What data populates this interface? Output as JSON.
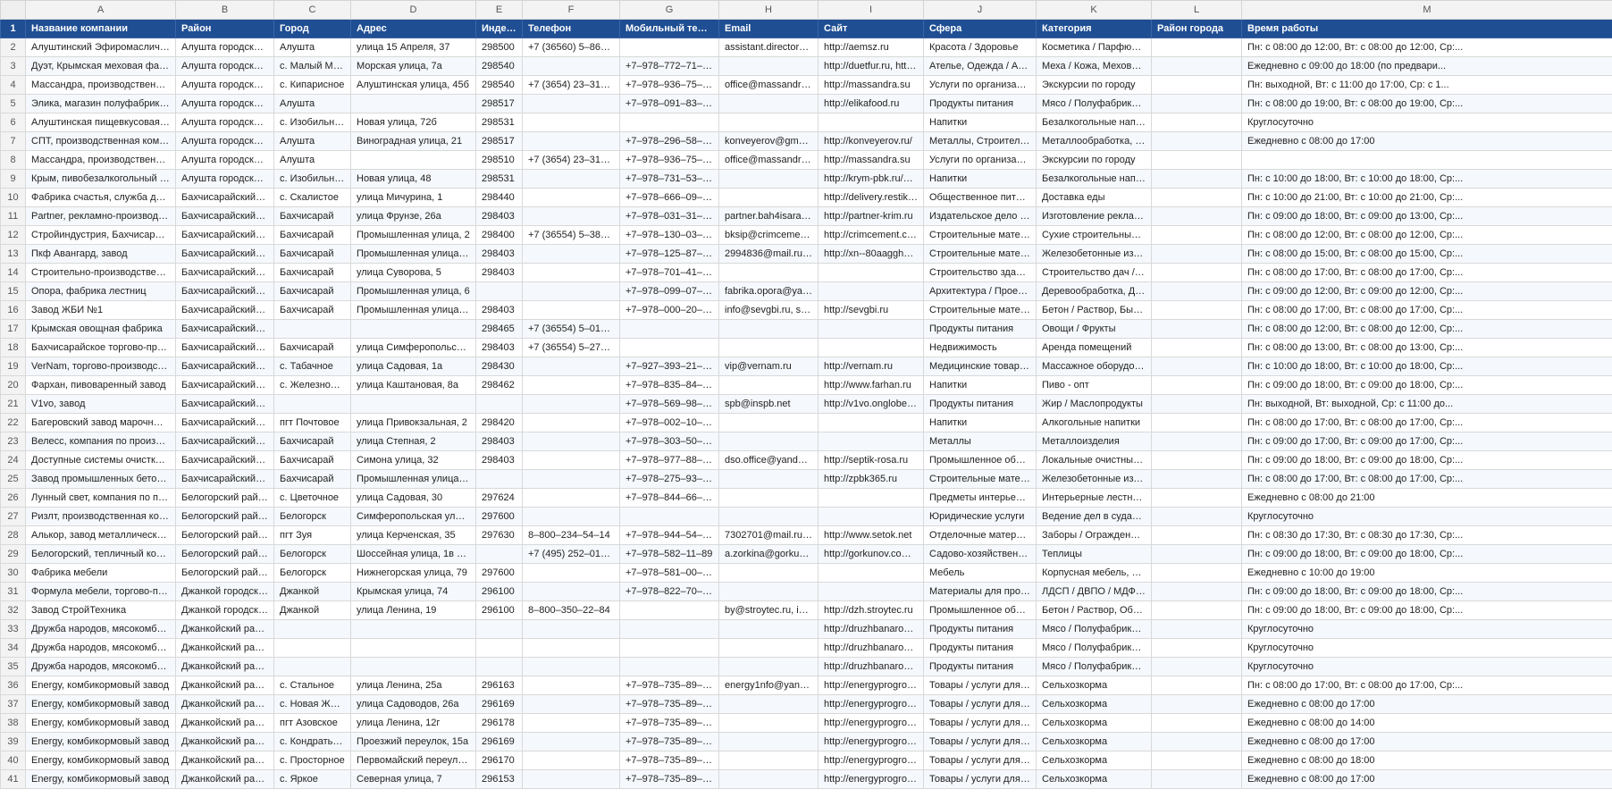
{
  "colors": {
    "header_bg": "#1f4e93",
    "header_text": "#ffffff",
    "grid_line": "#d9d9d9",
    "row_header_bg": "#f3f3f3"
  },
  "column_letters": [
    "A",
    "B",
    "C",
    "D",
    "E",
    "F",
    "G",
    "H",
    "I",
    "J",
    "K",
    "L",
    "M"
  ],
  "header": {
    "row_number": "1",
    "cells": [
      "Название компании",
      "Район",
      "Город",
      "Адрес",
      "Индекс",
      "Телефон",
      "Мобильный телефон",
      "Email",
      "Сайт",
      "Сфера",
      "Категория",
      "Район города",
      "Время работы"
    ]
  },
  "rows": [
    {
      "n": "2",
      "c": [
        "Алуштинский Эфиромасличный Совх...",
        "Алушта городской округ",
        "Алушта",
        "улица 15 Апреля, 37",
        "298500",
        "+7 (36560) 5–86–95",
        "",
        "assistant.director@aem...",
        "http://aemsz.ru",
        "Красота / Здоровье",
        "Косметика / Парфюмерия",
        "",
        "Пн: с 08:00 до 12:00, Вт: с 08:00 до 12:00, Ср:..."
      ]
    },
    {
      "n": "3",
      "c": [
        "Дуэт, Крымская меховая фабрика",
        "Алушта городской округ",
        "с. Малый Маяк",
        "Морская улица, 7а",
        "298540",
        "",
        "+7–978–772–71–73",
        "",
        "http://duetfur.ru, http://t...",
        "Ателье, Одежда / Аксессуа...",
        "Меха / Кожа, Меховые / к...",
        "",
        "Ежедневно с 09:00 до 18:00 (по предвари..."
      ]
    },
    {
      "n": "4",
      "c": [
        "Массандра, производственно-дегуста...",
        "Алушта городской округ",
        "с. Кипарисное",
        "Алуштинская улица, 45б",
        "298540",
        "+7 (3654) 23–31–96, +7...",
        "+7–978–936–75–04, +7...",
        "office@massandra.ru",
        "http://massandra.su",
        "Услуги по организации пр...",
        "Экскурсии по городу",
        "",
        "Пн: выходной, Вт: с 11:00 до 17:00, Ср: с 1..."
      ]
    },
    {
      "n": "5",
      "c": [
        "Элика, магазин полуфабрикатов",
        "Алушта городской округ",
        "Алушта",
        "",
        "298517",
        "",
        "+7–978–091–83–89",
        "",
        "http://elikafood.ru",
        "Продукты питания",
        "Мясо / Полуфабрикаты, Яг...",
        "",
        "Пн: с 08:00 до 19:00, Вт: с 08:00 до 19:00, Ср:..."
      ]
    },
    {
      "n": "6",
      "c": [
        "Алуштинская пищевкусовая фабрика",
        "Алушта городской округ",
        "с. Изобильное",
        "Новая улица, 72б",
        "298531",
        "",
        "",
        "",
        "",
        "Напитки",
        "Безалкогольные напитки",
        "",
        "Круглосуточно"
      ]
    },
    {
      "n": "7",
      "c": [
        "СПТ, производственная компания",
        "Алушта городской округ",
        "Алушта",
        "Виноградная улица, 21",
        "298517",
        "",
        "+7–978–296–58–60",
        "konveyerov@gmail.com",
        "http://konveyerov.ru/",
        "Металлы, Строительные / ...",
        "Металлообработка, Сваро...",
        "",
        "Ежедневно с 08:00 до 17:00"
      ]
    },
    {
      "n": "8",
      "c": [
        "Массандра, производственно-дегуста...",
        "Алушта городской округ",
        "Алушта",
        "",
        "298510",
        "+7 (3654) 23–31–96, +7...",
        "+7–978–936–75–04, +7...",
        "office@massandra.ru",
        "http://massandra.su",
        "Услуги по организации пр...",
        "Экскурсии по городу",
        "",
        ""
      ]
    },
    {
      "n": "9",
      "c": [
        "Крым, пивобезалкогольный комбинат",
        "Алушта городской округ",
        "с. Изобильное",
        "Новая улица, 48",
        "298531",
        "",
        "+7–978–731–53–35",
        "",
        "http://krym-pbk.ru/onas/f...",
        "Напитки",
        "Безалкогольные напитки, ...",
        "",
        "Пн: с 10:00 до 18:00, Вт: с 10:00 до 18:00, Ср:..."
      ]
    },
    {
      "n": "10",
      "c": [
        "Фабрика счастья, служба доставки ед...",
        "Бахчисарайский район",
        "с. Скалистое",
        "улица Мичурина, 1",
        "298440",
        "",
        "+7–978–666–09–00",
        "",
        "http://delivery.restik.com/...",
        "Общественное питание",
        "Доставка еды",
        "",
        "Пн: с 10:00 до 21:00, Вт: с 10:00 до 21:00, Ср:..."
      ]
    },
    {
      "n": "11",
      "c": [
        "Partner, рекламно-производственная ...",
        "Бахчисарайский район",
        "Бахчисарай",
        "улица Фрунзе, 26а",
        "298403",
        "",
        "+7–978–031–31–35, +7...",
        "partner.bah4isarai@gm...",
        "http://partner-krim.ru",
        "Издательское дело / Поли...",
        "Изготовление рекламных ...",
        "",
        "Пн: с 09:00 до 18:00, Вт: с 09:00 до 13:00, Ср:..."
      ]
    },
    {
      "n": "12",
      "c": [
        "Стройиндустрия, Бахчисарайский ко...",
        "Бахчисарайский район",
        "Бахчисарай",
        "Промышленная улица, 2",
        "298400",
        "+7 (36554) 5–38–24, +7...",
        "+7–978–130–03–82, +7...",
        "bksip@crimcement.com...",
        "http://crimcement.com",
        "Строительные материалы ...",
        "Сухие строительные смеси...",
        "",
        "Пн: с 08:00 до 12:00, Вт: с 08:00 до 12:00, Ср:..."
      ]
    },
    {
      "n": "13",
      "c": [
        "Пкф Авангард, завод",
        "Бахчисарайский район",
        "Бахчисарай",
        "Промышленная улица, 8б",
        "298403",
        "",
        "+7–978–125–87–16",
        "2994836@mail.ru, onlin...",
        "http://xn--80aaggh0b1a...",
        "Строительные материалы ...",
        "Железобетонные изделия",
        "",
        "Пн: с 08:00 до 15:00, Вт: с 08:00 до 15:00, Ср:..."
      ]
    },
    {
      "n": "14",
      "c": [
        "Строительно-производственная фирма",
        "Бахчисарайский район",
        "Бахчисарай",
        "улица Суворова, 5",
        "298403",
        "",
        "+7–978–701–41–01",
        "",
        "",
        "Строительство зданий / со...",
        "Строительство дач / котте...",
        "",
        "Пн: с 08:00 до 17:00, Вт: с 08:00 до 17:00, Ср:..."
      ]
    },
    {
      "n": "15",
      "c": [
        "Опора, фабрика лестниц",
        "Бахчисарайский район",
        "Бахчисарай",
        "Промышленная улица, 6",
        "",
        "",
        "+7–978–099–07–99, +7...",
        "fabrika.opora@ya.ru",
        "",
        "Архитектура / Проектиров...",
        "Деревообработка, Дизайн...",
        "",
        "Пн: с 09:00 до 12:00, Вт: с 09:00 до 12:00, Ср:..."
      ]
    },
    {
      "n": "16",
      "c": [
        "Завод ЖБИ №1",
        "Бахчисарайский район",
        "Бахчисарай",
        "Промышленная улица, 25",
        "298403",
        "",
        "+7–978–000–20–19",
        "info@sevgbi.ru, sale@s...",
        "http://sevgbi.ru",
        "Строительные материалы ...",
        "Бетон / Раствор, Быстрово...",
        "",
        "Пн: с 08:00 до 17:00, Вт: с 08:00 до 17:00, Ср:..."
      ]
    },
    {
      "n": "17",
      "c": [
        "Крымская овощная фабрика",
        "Бахчисарайский район",
        "",
        "",
        "298465",
        "+7 (36554) 5–01–00, +7...",
        "",
        "",
        "",
        "Продукты питания",
        "Овощи / Фрукты",
        "",
        "Пн: с 08:00 до 12:00, Вт: с 08:00 до 12:00, Ср:..."
      ]
    },
    {
      "n": "18",
      "c": [
        "Бахчисарайское торгово-производст...",
        "Бахчисарайский район",
        "Бахчисарай",
        "улица Симферопольская, 5а",
        "298403",
        "+7 (36554) 5–27–18",
        "",
        "",
        "",
        "Недвижимость",
        "Аренда помещений",
        "",
        "Пн: с 08:00 до 13:00, Вт: с 08:00 до 13:00, Ср:..."
      ]
    },
    {
      "n": "19",
      "c": [
        "VerNam, торгово-производственная к...",
        "Бахчисарайский район",
        "с. Табачное",
        "улица Садовая, 1а",
        "298430",
        "",
        "+7–927–393–21–00, +7...",
        "vip@vernam.ru",
        "http://vernam.ru",
        "Медицинские товары, Об...",
        "Массажное оборудование...",
        "",
        "Пн: с 10:00 до 18:00, Вт: с 10:00 до 18:00, Ср:..."
      ]
    },
    {
      "n": "20",
      "c": [
        "Фархан, пивоваренный завод",
        "Бахчисарайский район",
        "с. Железнодор...",
        "улица Каштановая, 8а",
        "298462",
        "",
        "+7–978–835–84–22, +7...",
        "",
        "http://www.farhan.ru",
        "Напитки",
        "Пиво - опт",
        "",
        "Пн: с 09:00 до 18:00, Вт: с 09:00 до 18:00, Ср:..."
      ]
    },
    {
      "n": "21",
      "c": [
        "V1vo, завод",
        "Бахчисарайский район",
        "",
        "",
        "",
        "",
        "+7–978–569–98–81",
        "spb@inspb.net",
        "http://v1vo.onglobe.ru",
        "Продукты питания",
        "Жир / Маслопродукты",
        "",
        "Пн: выходной, Вт: выходной, Ср: с 11:00 до..."
      ]
    },
    {
      "n": "22",
      "c": [
        "Багеровский завод марочных коньяк...",
        "Бахчисарайский район",
        "пгт Почтовое",
        "улица Привокзальная, 2",
        "298420",
        "",
        "+7–978–002–10–73",
        "",
        "",
        "Напитки",
        "Алкогольные напитки",
        "",
        "Пн: с 08:00 до 17:00, Вт: с 08:00 до 17:00, Ср:..."
      ]
    },
    {
      "n": "23",
      "c": [
        "Велесс, компания по производству ст...",
        "Бахчисарайский район",
        "Бахчисарай",
        "улица Степная, 2",
        "298403",
        "",
        "+7–978–303–50–69",
        "",
        "",
        "Металлы",
        "Металлоизделия",
        "",
        "Пн: с 09:00 до 17:00, Вт: с 09:00 до 17:00, Ср:..."
      ]
    },
    {
      "n": "24",
      "c": [
        "Доступные системы очистки, произв...",
        "Бахчисарайский район",
        "Бахчисарай",
        "Симона улица, 32",
        "298403",
        "",
        "+7–978–977–88–99, +7...",
        "dso.office@yandex.ru",
        "http://septik-rosa.ru",
        "Промышленное оборудов...",
        "Локальные очистные соор...",
        "",
        "Пн: с 09:00 до 18:00, Вт: с 09:00 до 18:00, Ср:..."
      ]
    },
    {
      "n": "25",
      "c": [
        "Завод промышленных бетонных конс...",
        "Бахчисарайский район",
        "Бахчисарай",
        "Промышленная улица, 28",
        "",
        "",
        "+7–978–275–93–35",
        "",
        "http://zpbk365.ru",
        "Строительные материалы ...",
        "Железобетонные изделия",
        "",
        "Пн: с 08:00 до 17:00, Вт: с 08:00 до 17:00, Ср:..."
      ]
    },
    {
      "n": "26",
      "c": [
        "Лунный свет, компания по производс...",
        "Белогорский район",
        "с. Цветочное",
        "улица Садовая, 30",
        "297624",
        "",
        "+7–978–844–66–46",
        "",
        "",
        "Предметы интерьера / экс...",
        "Интерьерные лестницы, К...",
        "",
        "Ежедневно с 08:00 до 21:00"
      ]
    },
    {
      "n": "27",
      "c": [
        "Ризлт, производственная компания",
        "Белогорский район",
        "Белогорск",
        "Симферопольская улица, 41",
        "297600",
        "",
        "",
        "",
        "",
        "Юридические услуги",
        "Ведение дел в судах, Колл...",
        "",
        "Круглосуточно"
      ]
    },
    {
      "n": "28",
      "c": [
        "Алькор, завод металлической сетки",
        "Белогорский район",
        "пгт Зуя",
        "улица Керченская, 35",
        "297630",
        "8–800–234–54–14",
        "+7–978–944–54–14",
        "7302701@mail.ru, 9445...",
        "http://www.setok.net",
        "Отделочные материалы, С...",
        "Заборы / Ограждения, Лак...",
        "",
        "Пн: с 08:30 до 17:30, Вт: с 08:30 до 17:30, Ср:..."
      ]
    },
    {
      "n": "29",
      "c": [
        "Белогорский, тепличный комбинат",
        "Белогорский район",
        "Белогорск",
        "Шоссейная улица, 1в лит А ст1",
        "",
        "+7 (495) 252–01–70",
        "+7–978–582–11–89",
        "a.zorkina@gorkunov.co...",
        "http://gorkunov.com/, htt...",
        "Садово-хозяйственные то...",
        "Теплицы",
        "",
        "Пн: с 09:00 до 18:00, Вт: с 09:00 до 18:00, Ср:..."
      ]
    },
    {
      "n": "30",
      "c": [
        "Фабрика мебели",
        "Белогорский район",
        "Белогорск",
        "Нижнегорская улица, 79",
        "297600",
        "",
        "+7–978–581–00–06",
        "",
        "",
        "Мебель",
        "Корпусная мебель, Мебел...",
        "",
        "Ежедневно с 10:00 до 19:00"
      ]
    },
    {
      "n": "31",
      "c": [
        "Формула мебели, торгово-производс...",
        "Джанкой городской ок...",
        "Джанкой",
        "Крымская улица, 74",
        "296100",
        "",
        "+7–978–822–70–38",
        "",
        "",
        "Материалы для производс...",
        "ЛДСП / ДВПО / МДФ, Меб...",
        "",
        "Пн: с 09:00 до 18:00, Вт: с 09:00 до 18:00, Ср:..."
      ]
    },
    {
      "n": "32",
      "c": [
        "Завод СтройТехника",
        "Джанкой городской ок...",
        "Джанкой",
        "улица Ленина, 19",
        "296100",
        "8–800–350–22–84",
        "",
        "by@stroytec.ru, info@st...",
        "http://dzh.stroytec.ru",
        "Промышленное оборудов...",
        "Бетон / Раствор, Оборудо...",
        "",
        "Пн: с 09:00 до 18:00, Вт: с 09:00 до 18:00, Ср:..."
      ]
    },
    {
      "n": "33",
      "c": [
        "Дружба народов, мясокомбинат",
        "Джанкойский район",
        "",
        "",
        "",
        "",
        "",
        "",
        "http://druzhbanarodov.ru",
        "Продукты питания",
        "Мясо / Полуфабрикаты",
        "",
        "Круглосуточно"
      ]
    },
    {
      "n": "34",
      "c": [
        "Дружба народов, мясокомбинат",
        "Джанкойский район",
        "",
        "",
        "",
        "",
        "",
        "",
        "http://druzhbanarodov.ru",
        "Продукты питания",
        "Мясо / Полуфабрикаты",
        "",
        "Круглосуточно"
      ]
    },
    {
      "n": "35",
      "c": [
        "Дружба народов, мясокомбинат",
        "Джанкойский район",
        "",
        "",
        "",
        "",
        "",
        "",
        "http://druzhbanarodov.ru",
        "Продукты питания",
        "Мясо / Полуфабрикаты",
        "",
        "Круглосуточно"
      ]
    },
    {
      "n": "36",
      "c": [
        "Energy, комбикормовый завод",
        "Джанкойский район",
        "с. Стальное",
        "улица Ленина, 25а",
        "296163",
        "",
        "+7–978–735–89–57",
        "energy1nfo@yandex.ru,...",
        "http://energyprogroup.ru",
        "Товары / услуги для живот...",
        "Сельхозкорма",
        "",
        "Пн: с 08:00 до 17:00, Вт: с 08:00 до 17:00, Ср:..."
      ]
    },
    {
      "n": "37",
      "c": [
        "Energy, комбикормовый завод",
        "Джанкойский район",
        "с. Новая Жизнь",
        "улица Садоводов, 26а",
        "296169",
        "",
        "+7–978–735–89–57",
        "",
        "http://energyprogroup.ru",
        "Товары / услуги для живот...",
        "Сельхозкорма",
        "",
        "Ежедневно с 08:00 до 17:00"
      ]
    },
    {
      "n": "38",
      "c": [
        "Energy, комбикормовый завод",
        "Джанкойский район",
        "пгт Азовское",
        "улица Ленина, 12г",
        "296178",
        "",
        "+7–978–735–89–57",
        "",
        "http://energyprogroup.ru",
        "Товары / услуги для живот...",
        "Сельхозкорма",
        "",
        "Ежедневно с 08:00 до 14:00"
      ]
    },
    {
      "n": "39",
      "c": [
        "Energy, комбикормовый завод",
        "Джанкойский район",
        "с. Кондратьево",
        "Проезжий переулок, 15а",
        "296169",
        "",
        "+7–978–735–89–57",
        "",
        "http://energyprogroup.ru",
        "Товары / услуги для живот...",
        "Сельхозкорма",
        "",
        "Ежедневно с 08:00 до 17:00"
      ]
    },
    {
      "n": "40",
      "c": [
        "Energy, комбикормовый завод",
        "Джанкойский район",
        "с. Просторное",
        "Первомайский переулок, 15",
        "296170",
        "",
        "+7–978–735–89–57",
        "",
        "http://energyprogroup.ru",
        "Товары / услуги для живот...",
        "Сельхозкорма",
        "",
        "Ежедневно с 08:00 до 18:00"
      ]
    },
    {
      "n": "41",
      "c": [
        "Energy, комбикормовый завод",
        "Джанкойский район",
        "с. Яркое",
        "Северная улица, 7",
        "296153",
        "",
        "+7–978–735–89–57",
        "",
        "http://energyprogroup.ru",
        "Товары / услуги для живот...",
        "Сельхозкорма",
        "",
        "Ежедневно с 08:00 до 17:00"
      ]
    }
  ]
}
